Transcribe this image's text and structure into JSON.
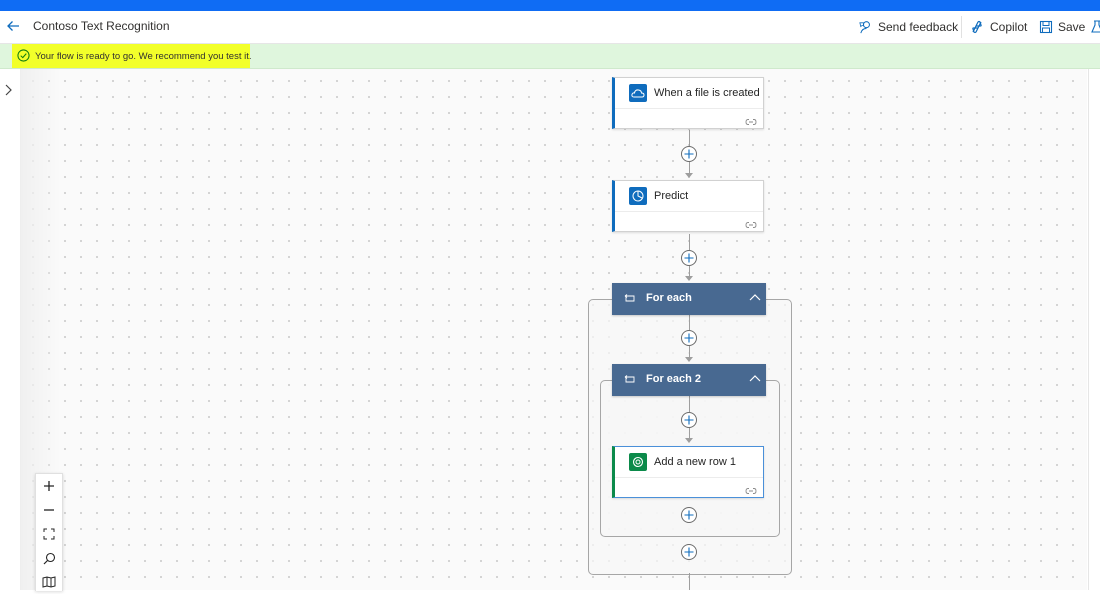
{
  "header": {
    "title": "Contoso Text Recognition",
    "send_feedback": "Send feedback",
    "copilot": "Copilot",
    "save": "Save"
  },
  "banner": {
    "message": "Your flow is ready to go. We recommend you test it.",
    "icon": "success-check-icon"
  },
  "flow": {
    "trigger": {
      "label": "When a file is created",
      "icon": "onedrive-cloud-icon",
      "color": "#0f6cbd"
    },
    "predict": {
      "label": "Predict",
      "icon": "ai-builder-icon",
      "color": "#0f6cbd"
    },
    "foreach1": {
      "label": "For each",
      "icon": "loop-icon"
    },
    "foreach2": {
      "label": "For each 2",
      "icon": "loop-icon"
    },
    "addrow": {
      "label": "Add a new row 1",
      "icon": "dataverse-icon",
      "color": "#0b8a4a"
    }
  },
  "colors": {
    "accent": "#0f6cf4",
    "scope_header": "#486991",
    "banner_bg": "#dff6dd",
    "highlight": "#f2ff2a"
  },
  "zoom_controls": [
    "zoom-in-icon",
    "zoom-out-icon",
    "fit-view-icon",
    "search-icon",
    "minimap-icon"
  ]
}
